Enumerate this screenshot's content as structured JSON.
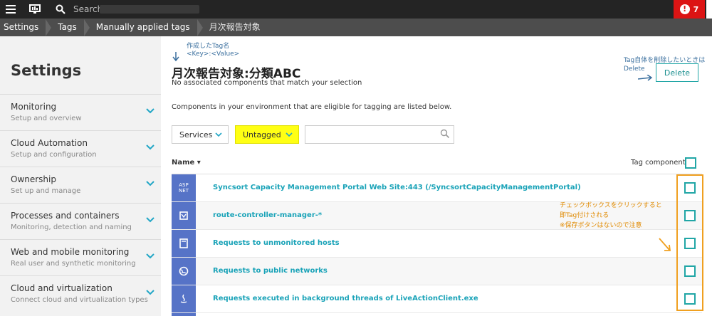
{
  "topbar": {
    "search_label": "Search",
    "alert_count": "7"
  },
  "breadcrumb": [
    "Settings",
    "Tags",
    "Manually applied tags",
    "月次報告対象"
  ],
  "sidebar": {
    "title": "Settings",
    "items": [
      {
        "title": "Monitoring",
        "subtitle": "Setup and overview"
      },
      {
        "title": "Cloud Automation",
        "subtitle": "Setup and configuration"
      },
      {
        "title": "Ownership",
        "subtitle": "Set up and manage"
      },
      {
        "title": "Processes and containers",
        "subtitle": "Monitoring, detection and naming"
      },
      {
        "title": "Web and mobile monitoring",
        "subtitle": "Real user and synthetic monitoring"
      },
      {
        "title": "Cloud and virtualization",
        "subtitle": "Connect cloud and virtualization types"
      }
    ]
  },
  "annotations": {
    "created_tag_name": "作成したTag名",
    "key_value": "<Key>:<Value>",
    "delete_hint": "Tag自体を削除したいときは",
    "delete_word": "Delete",
    "checkbox_line1": "チェックボックスをクリックすると",
    "checkbox_line2": "即Tag付けされる",
    "checkbox_line3": "※保存ボタンはないので注意"
  },
  "main": {
    "tag_title": "月次報告対象:分類ABC",
    "no_associated": "No associated components that match your selection",
    "delete_button": "Delete",
    "eligible_text": "Components in your environment that are eligible for tagging are listed below.",
    "services_select": "Services",
    "untagged_select": "Untagged",
    "filter_value": "",
    "col_name": "Name ▾",
    "col_tag": "Tag component"
  },
  "rows": [
    {
      "icon": "ASP\nNET",
      "label": "Syncsort Capacity Management Portal Web Site:443 (/SyncsortCapacityManagementPortal)"
    },
    {
      "icon": "",
      "label": "route-controller-manager-*"
    },
    {
      "icon": "",
      "label": "Requests to unmonitored hosts"
    },
    {
      "icon": "",
      "label": "Requests to public networks"
    },
    {
      "icon": "",
      "label": "Requests executed in background threads of LiveActionClient.exe"
    }
  ],
  "colors": {
    "accent": "#21a6a6",
    "link": "#1aa3b8",
    "highlight": "#ffff14",
    "annotation_orange": "#f0a020",
    "alert_red": "#dc1414",
    "service_icon": "#5673c7"
  }
}
